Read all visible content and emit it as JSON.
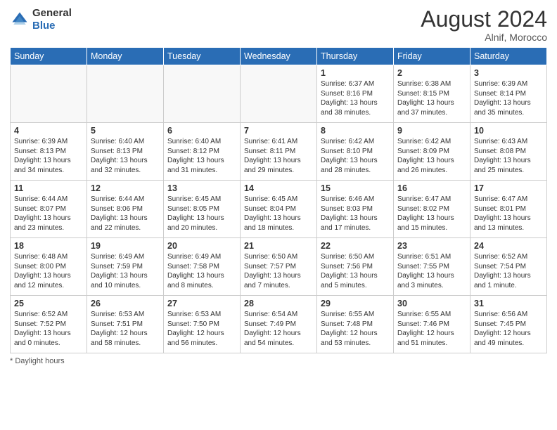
{
  "header": {
    "logo_general": "General",
    "logo_blue": "Blue",
    "month_year": "August 2024",
    "location": "Alnif, Morocco"
  },
  "days_of_week": [
    "Sunday",
    "Monday",
    "Tuesday",
    "Wednesday",
    "Thursday",
    "Friday",
    "Saturday"
  ],
  "footer": {
    "note": "Daylight hours"
  },
  "weeks": [
    [
      {
        "day": "",
        "sunrise": "",
        "sunset": "",
        "daylight": ""
      },
      {
        "day": "",
        "sunrise": "",
        "sunset": "",
        "daylight": ""
      },
      {
        "day": "",
        "sunrise": "",
        "sunset": "",
        "daylight": ""
      },
      {
        "day": "",
        "sunrise": "",
        "sunset": "",
        "daylight": ""
      },
      {
        "day": "1",
        "sunrise": "Sunrise: 6:37 AM",
        "sunset": "Sunset: 8:16 PM",
        "daylight": "Daylight: 13 hours and 38 minutes."
      },
      {
        "day": "2",
        "sunrise": "Sunrise: 6:38 AM",
        "sunset": "Sunset: 8:15 PM",
        "daylight": "Daylight: 13 hours and 37 minutes."
      },
      {
        "day": "3",
        "sunrise": "Sunrise: 6:39 AM",
        "sunset": "Sunset: 8:14 PM",
        "daylight": "Daylight: 13 hours and 35 minutes."
      }
    ],
    [
      {
        "day": "4",
        "sunrise": "Sunrise: 6:39 AM",
        "sunset": "Sunset: 8:13 PM",
        "daylight": "Daylight: 13 hours and 34 minutes."
      },
      {
        "day": "5",
        "sunrise": "Sunrise: 6:40 AM",
        "sunset": "Sunset: 8:13 PM",
        "daylight": "Daylight: 13 hours and 32 minutes."
      },
      {
        "day": "6",
        "sunrise": "Sunrise: 6:40 AM",
        "sunset": "Sunset: 8:12 PM",
        "daylight": "Daylight: 13 hours and 31 minutes."
      },
      {
        "day": "7",
        "sunrise": "Sunrise: 6:41 AM",
        "sunset": "Sunset: 8:11 PM",
        "daylight": "Daylight: 13 hours and 29 minutes."
      },
      {
        "day": "8",
        "sunrise": "Sunrise: 6:42 AM",
        "sunset": "Sunset: 8:10 PM",
        "daylight": "Daylight: 13 hours and 28 minutes."
      },
      {
        "day": "9",
        "sunrise": "Sunrise: 6:42 AM",
        "sunset": "Sunset: 8:09 PM",
        "daylight": "Daylight: 13 hours and 26 minutes."
      },
      {
        "day": "10",
        "sunrise": "Sunrise: 6:43 AM",
        "sunset": "Sunset: 8:08 PM",
        "daylight": "Daylight: 13 hours and 25 minutes."
      }
    ],
    [
      {
        "day": "11",
        "sunrise": "Sunrise: 6:44 AM",
        "sunset": "Sunset: 8:07 PM",
        "daylight": "Daylight: 13 hours and 23 minutes."
      },
      {
        "day": "12",
        "sunrise": "Sunrise: 6:44 AM",
        "sunset": "Sunset: 8:06 PM",
        "daylight": "Daylight: 13 hours and 22 minutes."
      },
      {
        "day": "13",
        "sunrise": "Sunrise: 6:45 AM",
        "sunset": "Sunset: 8:05 PM",
        "daylight": "Daylight: 13 hours and 20 minutes."
      },
      {
        "day": "14",
        "sunrise": "Sunrise: 6:45 AM",
        "sunset": "Sunset: 8:04 PM",
        "daylight": "Daylight: 13 hours and 18 minutes."
      },
      {
        "day": "15",
        "sunrise": "Sunrise: 6:46 AM",
        "sunset": "Sunset: 8:03 PM",
        "daylight": "Daylight: 13 hours and 17 minutes."
      },
      {
        "day": "16",
        "sunrise": "Sunrise: 6:47 AM",
        "sunset": "Sunset: 8:02 PM",
        "daylight": "Daylight: 13 hours and 15 minutes."
      },
      {
        "day": "17",
        "sunrise": "Sunrise: 6:47 AM",
        "sunset": "Sunset: 8:01 PM",
        "daylight": "Daylight: 13 hours and 13 minutes."
      }
    ],
    [
      {
        "day": "18",
        "sunrise": "Sunrise: 6:48 AM",
        "sunset": "Sunset: 8:00 PM",
        "daylight": "Daylight: 13 hours and 12 minutes."
      },
      {
        "day": "19",
        "sunrise": "Sunrise: 6:49 AM",
        "sunset": "Sunset: 7:59 PM",
        "daylight": "Daylight: 13 hours and 10 minutes."
      },
      {
        "day": "20",
        "sunrise": "Sunrise: 6:49 AM",
        "sunset": "Sunset: 7:58 PM",
        "daylight": "Daylight: 13 hours and 8 minutes."
      },
      {
        "day": "21",
        "sunrise": "Sunrise: 6:50 AM",
        "sunset": "Sunset: 7:57 PM",
        "daylight": "Daylight: 13 hours and 7 minutes."
      },
      {
        "day": "22",
        "sunrise": "Sunrise: 6:50 AM",
        "sunset": "Sunset: 7:56 PM",
        "daylight": "Daylight: 13 hours and 5 minutes."
      },
      {
        "day": "23",
        "sunrise": "Sunrise: 6:51 AM",
        "sunset": "Sunset: 7:55 PM",
        "daylight": "Daylight: 13 hours and 3 minutes."
      },
      {
        "day": "24",
        "sunrise": "Sunrise: 6:52 AM",
        "sunset": "Sunset: 7:54 PM",
        "daylight": "Daylight: 13 hours and 1 minute."
      }
    ],
    [
      {
        "day": "25",
        "sunrise": "Sunrise: 6:52 AM",
        "sunset": "Sunset: 7:52 PM",
        "daylight": "Daylight: 13 hours and 0 minutes."
      },
      {
        "day": "26",
        "sunrise": "Sunrise: 6:53 AM",
        "sunset": "Sunset: 7:51 PM",
        "daylight": "Daylight: 12 hours and 58 minutes."
      },
      {
        "day": "27",
        "sunrise": "Sunrise: 6:53 AM",
        "sunset": "Sunset: 7:50 PM",
        "daylight": "Daylight: 12 hours and 56 minutes."
      },
      {
        "day": "28",
        "sunrise": "Sunrise: 6:54 AM",
        "sunset": "Sunset: 7:49 PM",
        "daylight": "Daylight: 12 hours and 54 minutes."
      },
      {
        "day": "29",
        "sunrise": "Sunrise: 6:55 AM",
        "sunset": "Sunset: 7:48 PM",
        "daylight": "Daylight: 12 hours and 53 minutes."
      },
      {
        "day": "30",
        "sunrise": "Sunrise: 6:55 AM",
        "sunset": "Sunset: 7:46 PM",
        "daylight": "Daylight: 12 hours and 51 minutes."
      },
      {
        "day": "31",
        "sunrise": "Sunrise: 6:56 AM",
        "sunset": "Sunset: 7:45 PM",
        "daylight": "Daylight: 12 hours and 49 minutes."
      }
    ]
  ]
}
